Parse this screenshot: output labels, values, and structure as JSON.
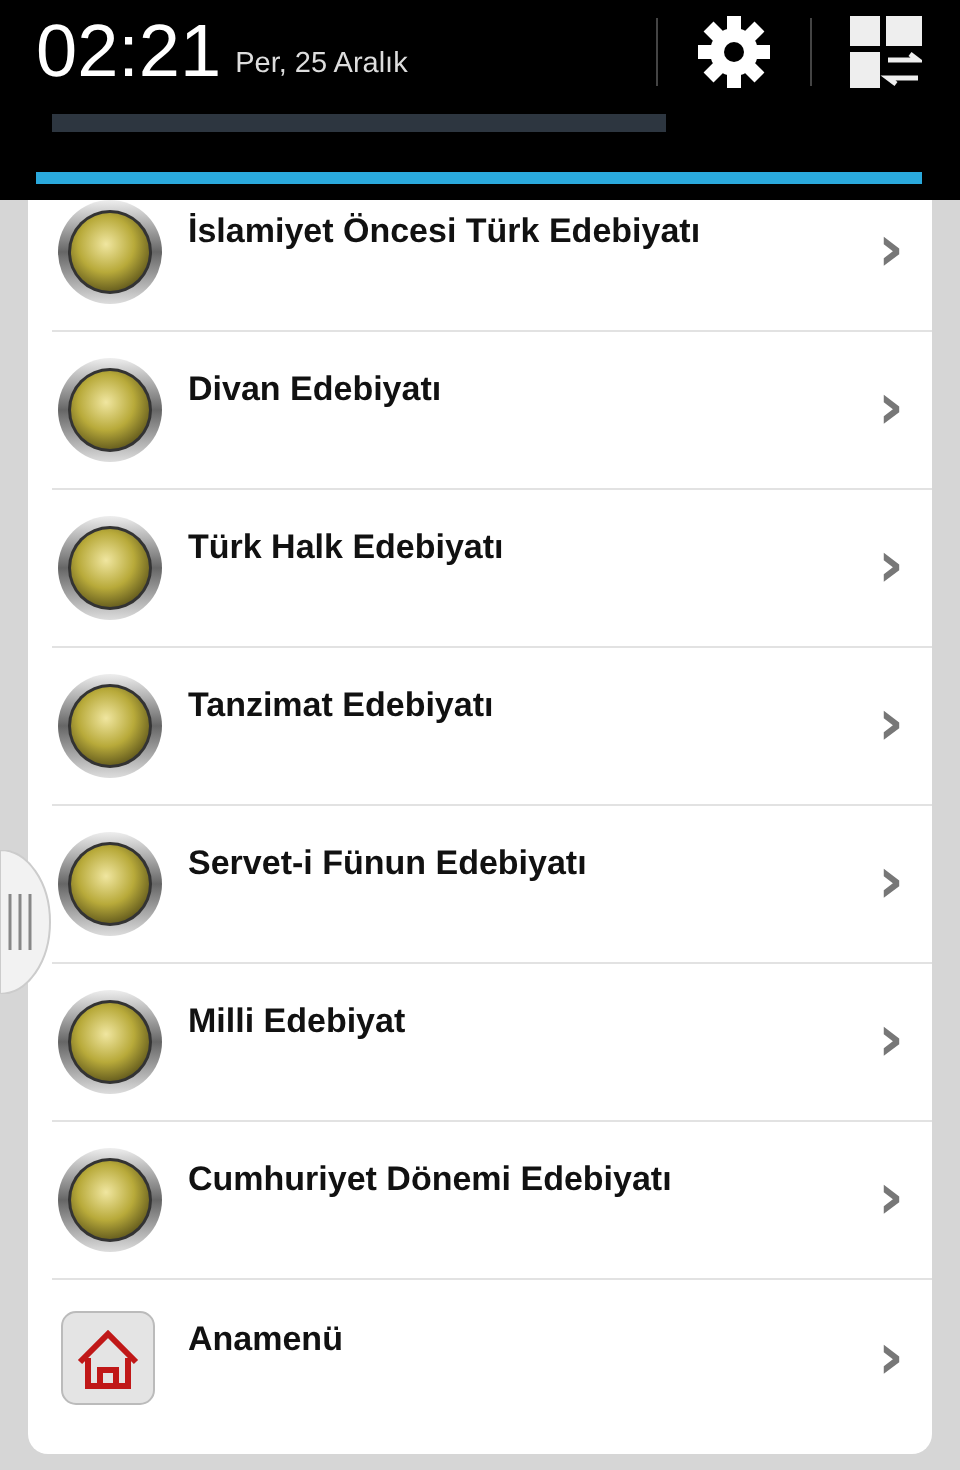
{
  "status_bar": {
    "time": "02:21",
    "date": "Per, 25 Aralık"
  },
  "menu": {
    "items": [
      {
        "kind": "bulb",
        "label": "İslamiyet Öncesi Türk Edebiyatı",
        "arrow": "›"
      },
      {
        "kind": "bulb",
        "label": "Divan Edebiyatı",
        "arrow": "›"
      },
      {
        "kind": "bulb",
        "label": "Türk Halk Edebiyatı",
        "arrow": "›"
      },
      {
        "kind": "bulb",
        "label": "Tanzimat Edebiyatı",
        "arrow": "›"
      },
      {
        "kind": "bulb",
        "label": "Servet-i Fünun Edebiyatı",
        "arrow": "›"
      },
      {
        "kind": "bulb",
        "label": "Milli Edebiyat",
        "arrow": "›"
      },
      {
        "kind": "bulb",
        "label": "Cumhuriyet Dönemi Edebiyatı",
        "arrow": "›"
      },
      {
        "kind": "home",
        "label": "Anamenü",
        "arrow": "›"
      }
    ]
  }
}
